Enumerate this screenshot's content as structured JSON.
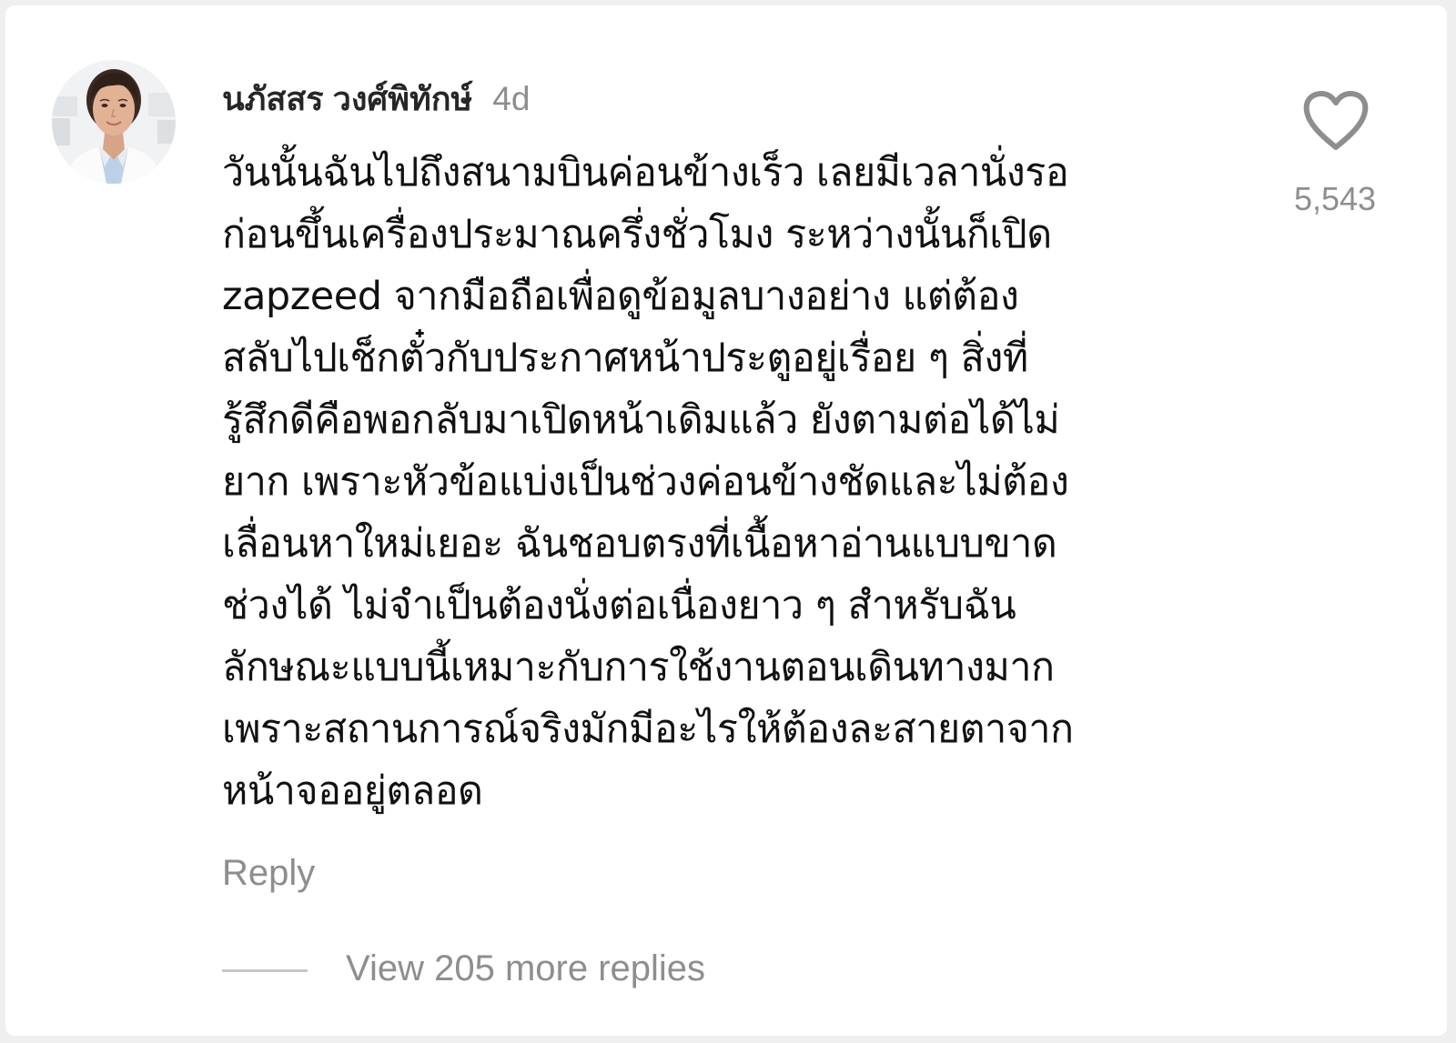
{
  "comment": {
    "username": "นภัสสร วงศ์พิทักษ์",
    "timestamp": "4d",
    "text_lines": [
      "วันนั้นฉันไปถึงสนามบินค่อนข้างเร็ว เลยมีเวลานั่งรอ",
      "ก่อนขึ้นเครื่องประมาณครึ่งชั่วโมง ระหว่างนั้นก็เปิด",
      "zapzeed จากมือถือเพื่อดูข้อมูลบางอย่าง แต่ต้อง",
      "สลับไปเช็กตั๋วกับประกาศหน้าประตูอยู่เรื่อย ๆ สิ่งที่",
      "รู้สึกดีคือพอกลับมาเปิดหน้าเดิมแล้ว ยังตามต่อได้ไม่",
      "ยาก เพราะหัวข้อแบ่งเป็นช่วงค่อนข้างชัดและไม่ต้อง",
      "เลื่อนหาใหม่เยอะ ฉันชอบตรงที่เนื้อหาอ่านแบบขาด",
      "ช่วงได้ ไม่จำเป็นต้องนั่งต่อเนื่องยาว ๆ สำหรับฉัน",
      "ลักษณะแบบนี้เหมาะกับการใช้งานตอนเดินทางมาก",
      "เพราะสถานการณ์จริงมักมีอะไรให้ต้องละสายตาจาก",
      "หน้าจออยู่ตลอด"
    ],
    "like_icon": "heart-outline-icon",
    "like_count": "5,543",
    "reply_label": "Reply",
    "view_replies_label": "View 205 more replies"
  },
  "colors": {
    "primary_text": "#111111",
    "secondary_text": "#8e8e8e",
    "divider": "#c7c7c7"
  }
}
